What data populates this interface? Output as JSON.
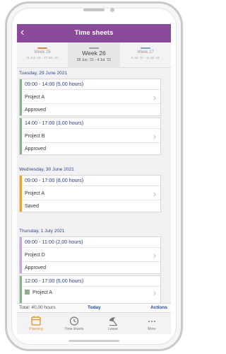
{
  "app": {
    "title": "Time sheets",
    "back_glyph": "‹"
  },
  "weeks": [
    {
      "label": "Week 25",
      "range": "21 Jun. '21 - 27 Jun. '21",
      "color": "#e08a4a"
    },
    {
      "label": "Week 26",
      "range": "28 Jun. '21 - 4 Jul. '21",
      "color": "#9aa0a8"
    },
    {
      "label": "Week 27",
      "range": "5 Jul. '21 - 11 Jul. '21",
      "color": "#7ea0cc"
    }
  ],
  "days": [
    {
      "header": "Tuesday, 29 June 2021",
      "entries": [
        {
          "time": "09:00 - 14:00 (5,00 hours)",
          "project": "Project A",
          "status": "Approved",
          "color": "#8db08a"
        },
        {
          "time": "14:00 - 17:00 (3,00 hours)",
          "project": "Project B",
          "status": "Approved",
          "color": "#8db08a"
        }
      ]
    },
    {
      "header": "Wednesday, 30 June 2021",
      "entries": [
        {
          "time": "09:00 - 17:00 (8,00 hours)",
          "project": "Project A",
          "status": "Saved",
          "color": "#e3a53a"
        }
      ]
    },
    {
      "header": "Thursday, 1 July 2021",
      "entries": [
        {
          "time": "09:00 - 11:00 (2,00 hours)",
          "project": "Project D",
          "status": "Approved",
          "color": "#c9a8d8"
        },
        {
          "time": "12:00 - 17:00 (5,00 hours)",
          "project": "Project A",
          "status": "",
          "color": "#8db08a"
        }
      ]
    }
  ],
  "summary": {
    "total": "Total: 40,00 hours",
    "today": "Today",
    "actions": "Actions"
  },
  "tabs": [
    {
      "label": "Planning",
      "icon": "calendar-icon",
      "active": true
    },
    {
      "label": "Time sheets",
      "icon": "clock-icon",
      "active": false
    },
    {
      "label": "Leave",
      "icon": "beach-umbrella-icon",
      "active": false
    },
    {
      "label": "More",
      "icon": "more-dots-icon",
      "active": false
    }
  ],
  "colors": {
    "accent": "#8a4a9a",
    "link": "#2d4a8a",
    "active_tab": "#e3921f"
  }
}
